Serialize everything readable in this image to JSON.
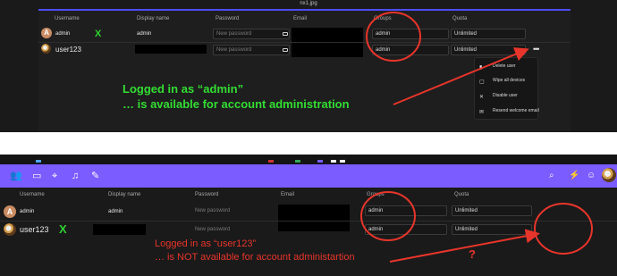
{
  "window_caption": "nx1.jpg",
  "top": {
    "headers": [
      "Username",
      "Display name",
      "Password",
      "Email",
      "Groups",
      "Quota"
    ],
    "rows": [
      {
        "avatar_letter": "A",
        "username": "admin",
        "display_name": "admin",
        "password_placeholder": "New password",
        "group": "admin",
        "quota": "Unlimited"
      },
      {
        "username": "user123",
        "password_placeholder": "New password",
        "group": "admin",
        "quota": "Unlimited"
      }
    ],
    "check_mark": "X",
    "menu_items": [
      {
        "label": "Delete user",
        "icon": "trash-icon"
      },
      {
        "label": "Wipe all devices",
        "icon": "wipe-icon"
      },
      {
        "label": "Disable user",
        "icon": "close-icon"
      },
      {
        "label": "Resend welcome email",
        "icon": "mail-icon"
      }
    ],
    "annotation_line1": "Logged in as “admin”",
    "annotation_line2": "… is available for account administration",
    "annotation_color": "#33dd33"
  },
  "bottom": {
    "headers": [
      "Username",
      "Display name",
      "Password",
      "Email",
      "Groups",
      "Quota"
    ],
    "rows": [
      {
        "avatar_letter": "A",
        "username": "admin",
        "display_name": "admin",
        "password_placeholder": "New password",
        "group": "admin",
        "quota": "Unlimited"
      },
      {
        "username": "user123",
        "password_placeholder": "New password",
        "group": "admin",
        "quota": "Unlimited"
      }
    ],
    "check_mark": "X",
    "annotation_line1": "Logged in as “user123”",
    "annotation_line2": "… is NOT available for account administartion",
    "question_mark": "?",
    "annotation_color": "#e8352b",
    "navbar_color": "#7a5cff",
    "nav_icons": [
      "contacts-icon",
      "folder-icon",
      "location-icon",
      "music-icon",
      "wrench-icon"
    ],
    "nav_right_icons": [
      "search-icon",
      "bolt-icon",
      "user-icon",
      "avatar"
    ]
  }
}
